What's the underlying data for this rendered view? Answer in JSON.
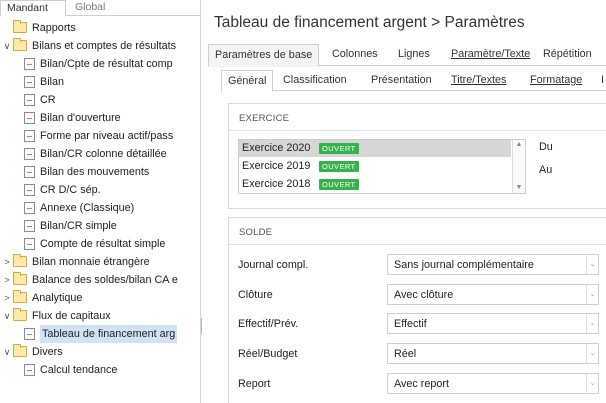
{
  "nav_tabs": [
    "Mandant",
    "Global"
  ],
  "tree": [
    {
      "label": "Rapports",
      "type": "folder",
      "toggle": ""
    },
    {
      "label": "Bilans et comptes de résultats",
      "type": "folder",
      "toggle": "∨"
    },
    {
      "label": "Bilan/Cpte de résultat comp",
      "type": "doc",
      "toggle": ""
    },
    {
      "label": "Bilan",
      "type": "doc",
      "toggle": ""
    },
    {
      "label": "CR",
      "type": "doc",
      "toggle": ""
    },
    {
      "label": "Bilan d'ouverture",
      "type": "doc",
      "toggle": ""
    },
    {
      "label": "Forme par niveau actif/pass",
      "type": "doc",
      "toggle": ""
    },
    {
      "label": "Bilan/CR colonne détaillée",
      "type": "doc",
      "toggle": ""
    },
    {
      "label": "Bilan des mouvements",
      "type": "doc",
      "toggle": ""
    },
    {
      "label": "CR D/C sép.",
      "type": "doc",
      "toggle": ""
    },
    {
      "label": "Annexe (Classique)",
      "type": "doc",
      "toggle": ""
    },
    {
      "label": "Bilan/CR simple",
      "type": "doc",
      "toggle": ""
    },
    {
      "label": "Compte de résultat simple",
      "type": "doc",
      "toggle": ""
    },
    {
      "label": "Bilan monnaie étrangère",
      "type": "folder",
      "toggle": ">"
    },
    {
      "label": "Balance des soldes/bilan CA e",
      "type": "folder",
      "toggle": ">"
    },
    {
      "label": "Analytique",
      "type": "folder",
      "toggle": ">"
    },
    {
      "label": "Flux de capitaux",
      "type": "folder",
      "toggle": "∨"
    },
    {
      "label": "Tableau de financement arg",
      "type": "doc",
      "toggle": "",
      "selected": true
    },
    {
      "label": "Divers",
      "type": "folder",
      "toggle": "∨"
    },
    {
      "label": "Calcul tendance",
      "type": "doc",
      "toggle": ""
    }
  ],
  "header": {
    "title": "Tableau de financement argent > Paramètres"
  },
  "tabs_main": [
    {
      "label": "Paramètres de base",
      "active": true
    },
    {
      "label": "Colonnes",
      "active": false
    },
    {
      "label": "Lignes",
      "active": false
    },
    {
      "label": "Paramètre/Texte",
      "active": false
    },
    {
      "label": "Répétition",
      "active": false
    }
  ],
  "tabs_sub": [
    {
      "label": "Général",
      "active": true
    },
    {
      "label": "Classification",
      "active": false
    },
    {
      "label": "Présentation",
      "active": false
    },
    {
      "label": "Titre/Textes",
      "active": false
    },
    {
      "label": "Formatage",
      "active": false
    },
    {
      "label": "I",
      "active": false
    }
  ],
  "exercice": {
    "section_title": "EXERCICE",
    "items": [
      {
        "label": "Exercice 2020",
        "status": "OUVERT",
        "selected": true
      },
      {
        "label": "Exercice 2019",
        "status": "OUVERT",
        "selected": false
      },
      {
        "label": "Exercice 2018",
        "status": "OUVERT",
        "selected": false
      }
    ],
    "du_label": "Du",
    "au_label": "Au"
  },
  "solde": {
    "section_title": "SOLDE",
    "fields": [
      {
        "label": "Journal compl.",
        "value": "Sans journal complémentaire"
      },
      {
        "label": "Clôture",
        "value": "Avec clôture"
      },
      {
        "label": "Effectif/Prév.",
        "value": "Effectif"
      },
      {
        "label": "Réel/Budget",
        "value": "Réel"
      },
      {
        "label": "Report",
        "value": "Avec report"
      }
    ]
  },
  "colors": {
    "status_badge": "#35b34a",
    "folder": "#fde9a8",
    "selection": "#cfe3f5"
  }
}
